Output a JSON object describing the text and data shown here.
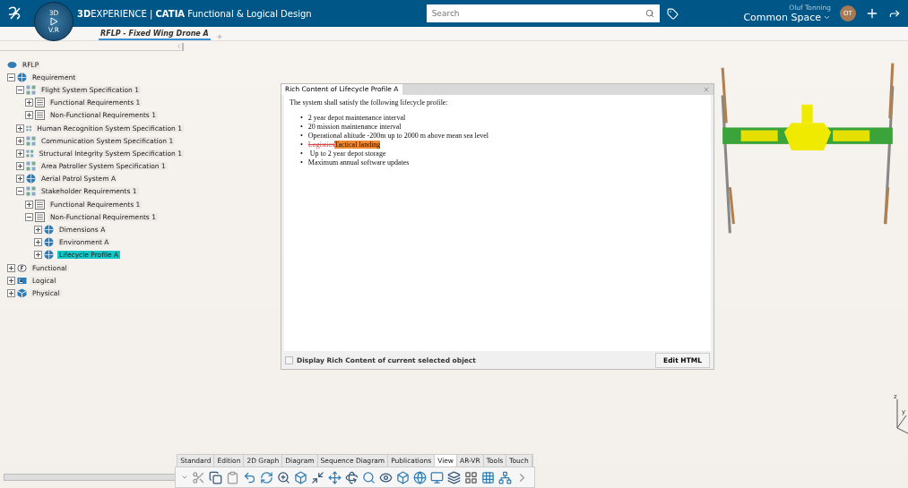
{
  "header": {
    "title": "**3D**EXPERIENCE | **CATIA** Functional & Logical Design",
    "compass_labels": [
      "3D",
      "V.R"
    ],
    "search": {
      "placeholder": "Search"
    },
    "user": "Oluf Tonning",
    "space": "Common Space",
    "avatar": "OT"
  },
  "tabs": [
    {
      "label": "RFLP - Fixed Wing Drone A",
      "selected": true
    }
  ],
  "tree": {
    "label": "RFLP",
    "children": [
      {
        "label": "Requirement",
        "kind": "globe",
        "expanded": true,
        "selected": false,
        "children": [
          {
            "label": "Flight System Specification 1",
            "kind": "spec",
            "expanded": true,
            "selected": false,
            "children": [
              {
                "label": "Functional Requirements 1",
                "kind": "doc",
                "expanded": false,
                "selected": false
              },
              {
                "label": "Non-Functional Requirements 1",
                "kind": "doc",
                "expanded": false,
                "selected": false
              }
            ]
          },
          {
            "label": "Human Recognition System Specification 1",
            "kind": "spec",
            "expanded": false,
            "selected": false
          },
          {
            "label": "Communication System Specification 1",
            "kind": "spec",
            "expanded": false,
            "selected": false
          },
          {
            "label": "Structural Integrity System Specification 1",
            "kind": "spec",
            "expanded": false,
            "selected": false
          },
          {
            "label": "Area Patroller System Specification 1",
            "kind": "spec",
            "expanded": false,
            "selected": false
          },
          {
            "label": "Aerial Patrol System A",
            "kind": "globe",
            "expanded": false,
            "selected": false
          },
          {
            "label": "Stakeholder Requirements 1",
            "kind": "spec",
            "expanded": true,
            "selected": false,
            "children": [
              {
                "label": "Functional Requirements 1",
                "kind": "doc",
                "expanded": false,
                "selected": false
              },
              {
                "label": "Non-Functional Requirements 1",
                "kind": "doc",
                "expanded": true,
                "selected": false,
                "children": [
                  {
                    "label": "Dimensions A",
                    "kind": "globe",
                    "expanded": false,
                    "selected": false
                  },
                  {
                    "label": "Environment A",
                    "kind": "globe",
                    "expanded": false,
                    "selected": false
                  },
                  {
                    "label": "Lifecycle Profile A",
                    "kind": "globe",
                    "expanded": false,
                    "selected": true
                  }
                ]
              }
            ]
          }
        ]
      },
      {
        "label": "Functional",
        "kind": "functional",
        "expanded": false,
        "selected": false
      },
      {
        "label": "Logical",
        "kind": "logical",
        "expanded": false,
        "selected": false
      },
      {
        "label": "Physical",
        "kind": "physical",
        "expanded": false,
        "selected": false
      }
    ]
  },
  "dialog": {
    "title": "Rich Content of Lifecycle Profile A",
    "intro": "The system shall satisfy the following lifecycle profile:",
    "items": [
      {
        "kind": "plain",
        "bullet": "•",
        "text": "2 year depot maintenance interval"
      },
      {
        "kind": "plain",
        "bullet": "•",
        "text": "20 mission maintenance interval"
      },
      {
        "kind": "plain",
        "bullet": "•",
        "text": "Operational altitude -200m up to 2000 m above mean sea level"
      },
      {
        "kind": "change",
        "bullet": "•",
        "deleted": "Logistics",
        "inserted": "Tactical landing"
      },
      {
        "kind": "plain",
        "bullet": "•",
        "text": " Up to 2 year depot storage"
      },
      {
        "kind": "plain",
        "bullet": "•",
        "text": "Maximum annual software updates"
      }
    ],
    "checkbox": {
      "label": "Display Rich Content of current selected object",
      "checked": false
    },
    "button": "Edit HTML"
  },
  "axis_labels": [
    "z",
    "y"
  ],
  "toolbar_tabs": [
    {
      "label": "Standard",
      "selected": false
    },
    {
      "label": "Edition",
      "selected": false
    },
    {
      "label": "2D Graph",
      "selected": false
    },
    {
      "label": "Diagram",
      "selected": false
    },
    {
      "label": "Sequence Diagram",
      "selected": false
    },
    {
      "label": "Publications",
      "selected": false
    },
    {
      "label": "View",
      "selected": true
    },
    {
      "label": "AR-VR",
      "selected": false
    },
    {
      "label": "Tools",
      "selected": false
    },
    {
      "label": "Touch",
      "selected": false
    }
  ]
}
